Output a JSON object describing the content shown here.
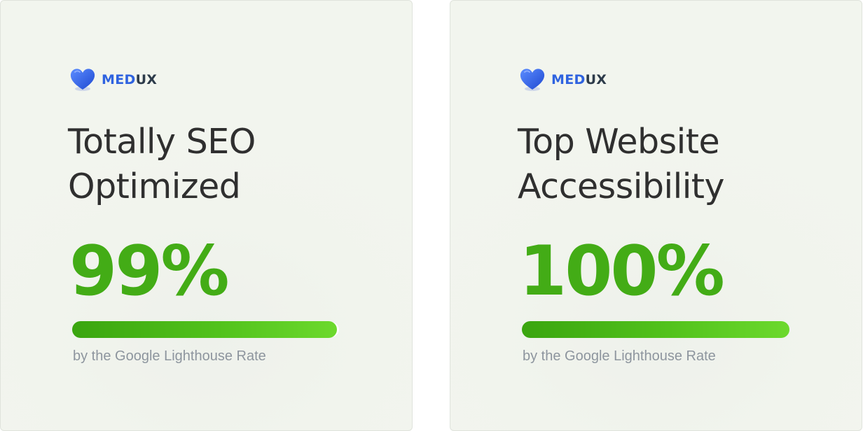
{
  "brand": {
    "med": "MED",
    "ux": "UX",
    "icon": "heart-icon",
    "color": "#2f63e0"
  },
  "cards": [
    {
      "title_line1": "Totally SEO",
      "title_line2": "Optimized",
      "percent_label": "99%",
      "score": 0.99,
      "caption": "by the Google Lighthouse Rate"
    },
    {
      "title_line1": "Top Website",
      "title_line2": "Accessibility",
      "percent_label": "100%",
      "score": 1.0,
      "caption": "by the Google Lighthouse Rate"
    }
  ],
  "colors": {
    "accent_green": "#43ac16",
    "title_text": "#2f2f2f",
    "caption_text": "#8d959e"
  }
}
